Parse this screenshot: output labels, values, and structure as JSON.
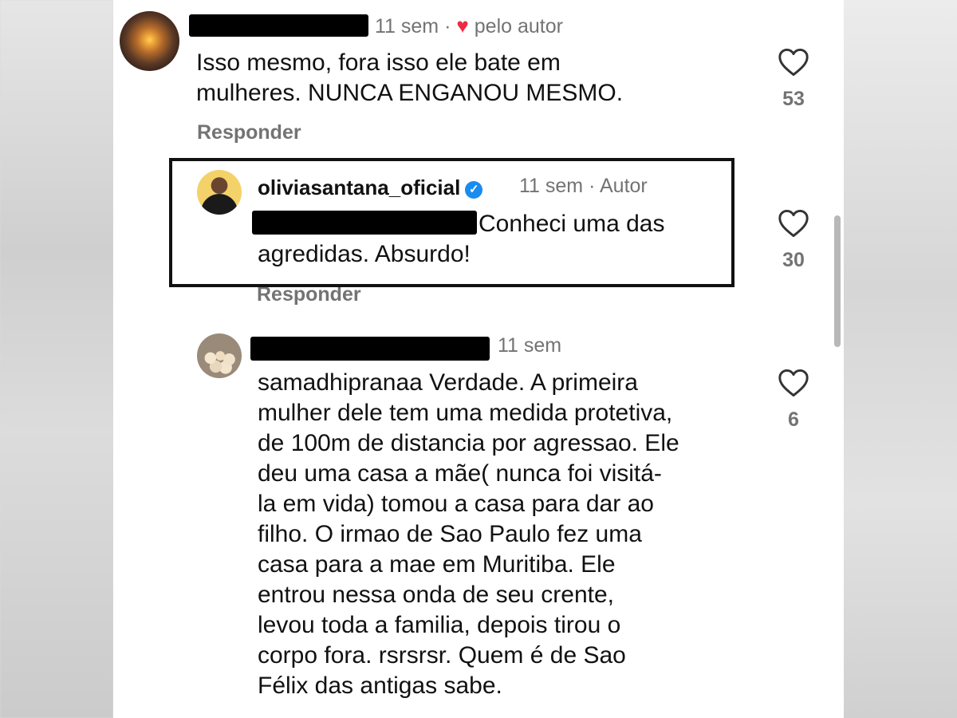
{
  "comments": [
    {
      "time": "11 sem",
      "author_badge": "pelo autor",
      "text_lines": [
        "Isso mesmo, fora isso ele bate em",
        "mulheres. NUNCA ENGANOU MESMO."
      ],
      "reply_label": "Responder",
      "likes": "53"
    },
    {
      "username": "oliviasantana_oficial",
      "time": "11 sem",
      "role": "Autor",
      "text_lines": [
        "Conheci uma das",
        "agredidas. Absurdo!"
      ],
      "reply_label": "Responder",
      "likes": "30"
    },
    {
      "time": "11 sem",
      "text_lines": [
        "samadhipranaa Verdade. A primeira",
        "mulher dele tem uma medida protetiva,",
        "de 100m de distancia por agressao. Ele",
        "deu uma casa a mãe( nunca foi visitá-",
        "la em vida) tomou a casa para dar ao",
        "filho. O irmao de Sao Paulo fez uma",
        "casa para a mae em Muritiba. Ele",
        "entrou nessa onda de seu crente,",
        "levou toda a familia, depois tirou o",
        "corpo fora. rsrsrsr. Quem é de Sao",
        "Félix das antigas sabe."
      ],
      "likes": "6"
    }
  ],
  "icons": {
    "like": "heart-outline-icon",
    "author_like": "heart-filled-icon",
    "verified": "verified-badge-icon"
  },
  "colors": {
    "author_heart": "#ed2b43",
    "verified": "#1a8cf0",
    "muted": "#737373"
  }
}
